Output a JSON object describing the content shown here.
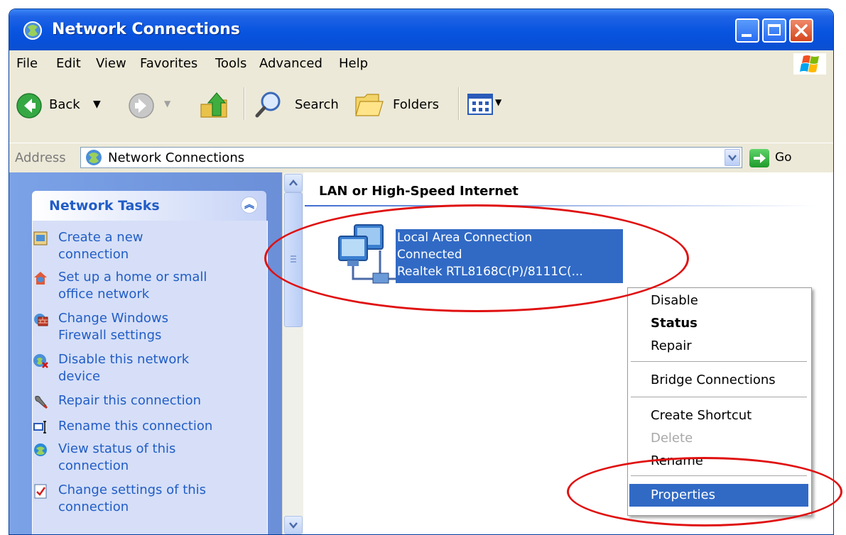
{
  "window": {
    "title": "Network Connections"
  },
  "menubar": {
    "items": [
      "File",
      "Edit",
      "View",
      "Favorites",
      "Tools",
      "Advanced",
      "Help"
    ]
  },
  "toolbar": {
    "back_label": "Back",
    "search_label": "Search",
    "folders_label": "Folders"
  },
  "addressbar": {
    "label": "Address",
    "value": "Network Connections",
    "go_label": "Go"
  },
  "taskpane": {
    "title": "Network Tasks",
    "tasks": [
      {
        "line1": "Create a new",
        "line2": "connection",
        "icon": "new-connection-icon"
      },
      {
        "line1": "Set up a home or small",
        "line2": "office network",
        "icon": "home-network-icon"
      },
      {
        "line1": "Change Windows",
        "line2": "Firewall settings",
        "icon": "firewall-icon"
      },
      {
        "line1": "Disable this network",
        "line2": "device",
        "icon": "disable-icon"
      },
      {
        "line1": "Repair this connection",
        "line2": "",
        "icon": "repair-icon"
      },
      {
        "line1": "Rename this connection",
        "line2": "",
        "icon": "rename-icon"
      },
      {
        "line1": "View status of this",
        "line2": "connection",
        "icon": "status-icon"
      },
      {
        "line1": "Change settings of this",
        "line2": "connection",
        "icon": "settings-icon"
      }
    ]
  },
  "content": {
    "group_title": "LAN or High-Speed Internet",
    "connection": {
      "name": "Local Area Connection",
      "status": "Connected",
      "adapter": "Realtek RTL8168C(P)/8111C(..."
    }
  },
  "context_menu": {
    "items": [
      {
        "label": "Disable"
      },
      {
        "label": "Status"
      },
      {
        "label": "Repair"
      },
      {
        "label": "Bridge Connections"
      },
      {
        "label": "Create Shortcut"
      },
      {
        "label": "Delete"
      },
      {
        "label": "Rename"
      },
      {
        "label": "Properties"
      }
    ]
  },
  "colors": {
    "titlebar": "#0a56e0",
    "selection": "#316ac5",
    "annotation": "#e01010",
    "task_link": "#215dc6"
  }
}
